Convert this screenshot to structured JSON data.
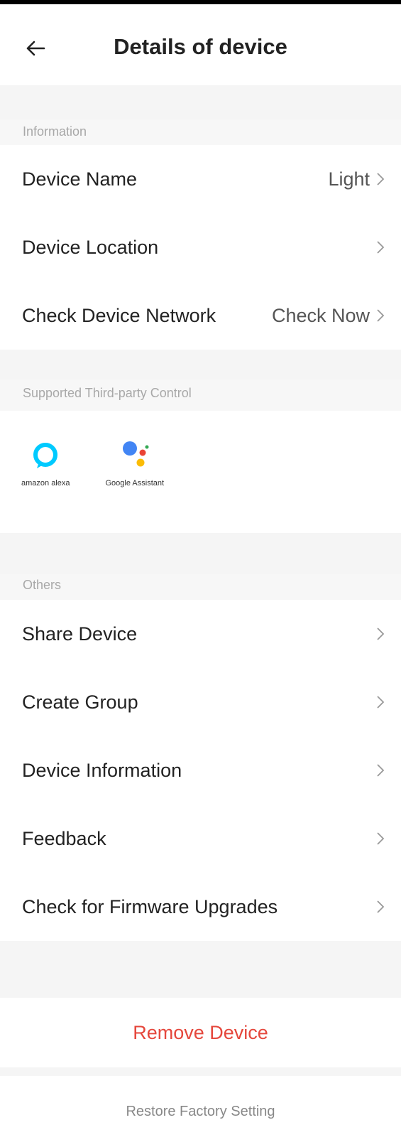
{
  "header": {
    "title": "Details of device",
    "back_icon": "arrow-left-icon"
  },
  "sections": {
    "information": {
      "label": "Information",
      "rows": [
        {
          "label": "Device Name",
          "value": "Light"
        },
        {
          "label": "Device Location",
          "value": ""
        },
        {
          "label": "Check Device Network",
          "value": "Check Now"
        }
      ]
    },
    "third_party": {
      "label": "Supported Third-party Control",
      "items": [
        {
          "name": "amazon alexa",
          "icon": "alexa-icon",
          "color": "#00caff"
        },
        {
          "name": "Google Assistant",
          "icon": "google-assistant-icon",
          "colors": [
            "#4285f4",
            "#ea4335",
            "#fbbc05",
            "#34a853"
          ]
        }
      ]
    },
    "others": {
      "label": "Others",
      "rows": [
        {
          "label": "Share Device"
        },
        {
          "label": "Create Group"
        },
        {
          "label": "Device Information"
        },
        {
          "label": "Feedback"
        },
        {
          "label": "Check for Firmware Upgrades"
        }
      ]
    }
  },
  "actions": {
    "remove_label": "Remove Device",
    "restore_label": "Restore Factory Setting",
    "remove_color": "#e5473c"
  }
}
